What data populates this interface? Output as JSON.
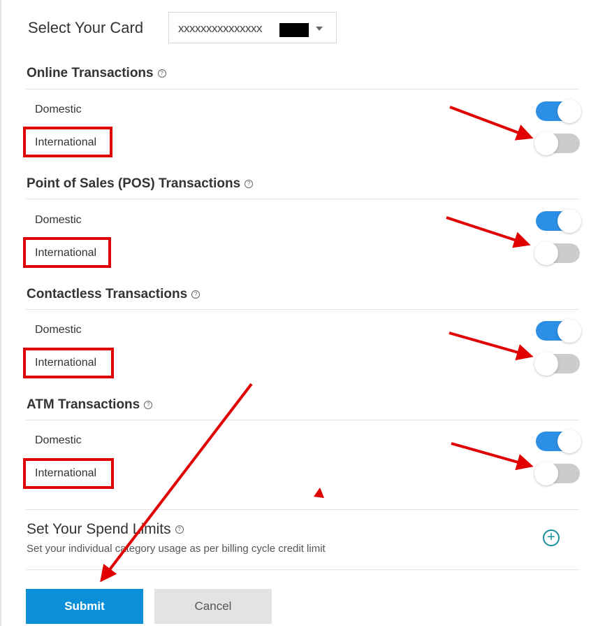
{
  "card_selector": {
    "label": "Select Your Card",
    "value": "xxxxxxxxxxxxxxx"
  },
  "sections": [
    {
      "title": "Online Transactions",
      "rows": [
        {
          "label": "Domestic",
          "enabled": true
        },
        {
          "label": "International",
          "enabled": false
        }
      ]
    },
    {
      "title": "Point of Sales (POS) Transactions",
      "rows": [
        {
          "label": "Domestic",
          "enabled": true
        },
        {
          "label": "International",
          "enabled": false
        }
      ]
    },
    {
      "title": "Contactless Transactions",
      "rows": [
        {
          "label": "Domestic",
          "enabled": true
        },
        {
          "label": "International",
          "enabled": false
        }
      ]
    },
    {
      "title": "ATM Transactions",
      "rows": [
        {
          "label": "Domestic",
          "enabled": true
        },
        {
          "label": "International",
          "enabled": false
        }
      ]
    }
  ],
  "help_icon": "?",
  "spend_limits": {
    "title": "Set Your Spend Limits",
    "subtitle": "Set your individual category usage as per billing cycle credit limit",
    "add_icon": "+"
  },
  "buttons": {
    "submit": "Submit",
    "cancel": "Cancel"
  },
  "colors": {
    "toggle_on": "#2b8fe6",
    "toggle_off": "#cccccc",
    "submit_bg": "#0b8fd8",
    "annotation_red": "#e00000"
  }
}
